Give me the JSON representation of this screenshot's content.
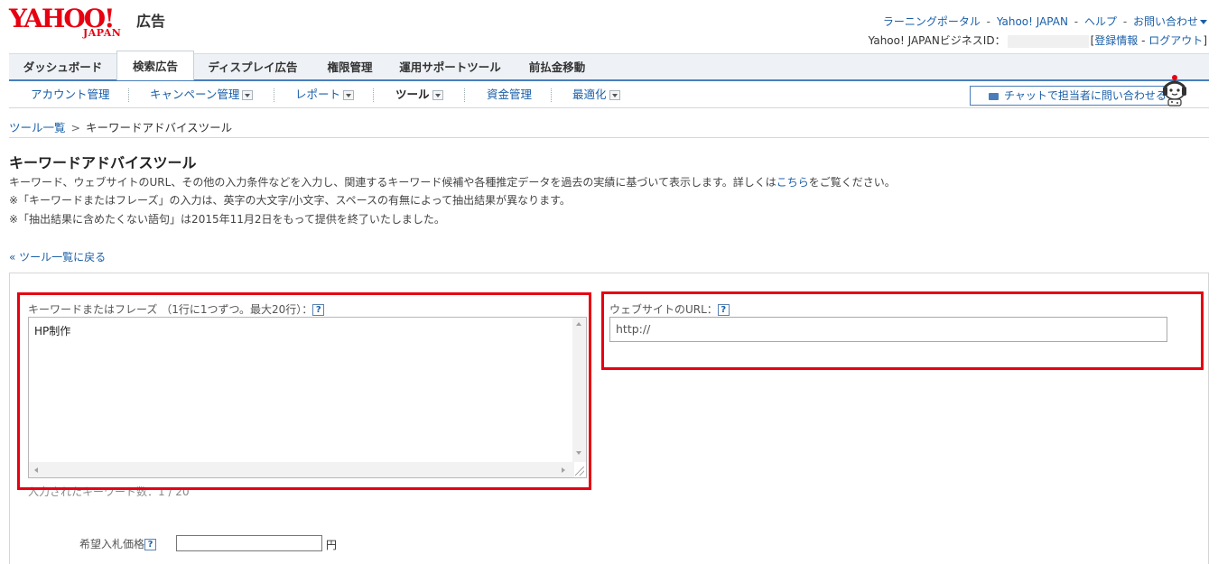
{
  "brand": {
    "logo_main": "YAHOO!",
    "logo_sub": "JAPAN",
    "logo_product": "広告"
  },
  "top_links": {
    "items": [
      "ラーニングポータル",
      "Yahoo! JAPAN",
      "ヘルプ",
      "お問い合わせ"
    ],
    "separator": "-"
  },
  "account": {
    "bizid_label": "Yahoo! JAPANビジネスID：",
    "bracket_open": "[",
    "registration": "登録情報",
    "separator": "-",
    "logout": "ログアウト",
    "bracket_close": "]"
  },
  "main_tabs": [
    {
      "label": "ダッシュボード",
      "active": false
    },
    {
      "label": "検索広告",
      "active": true
    },
    {
      "label": "ディスプレイ広告",
      "active": false
    },
    {
      "label": "権限管理",
      "active": false
    },
    {
      "label": "運用サポートツール",
      "active": false
    },
    {
      "label": "前払金移動",
      "active": false
    }
  ],
  "sub_nav": [
    {
      "label": "アカウント管理",
      "dropdown": false,
      "current": false
    },
    {
      "label": "キャンペーン管理",
      "dropdown": true,
      "current": false
    },
    {
      "label": "レポート",
      "dropdown": true,
      "current": false
    },
    {
      "label": "ツール",
      "dropdown": true,
      "current": true
    },
    {
      "label": "資金管理",
      "dropdown": false,
      "current": false
    },
    {
      "label": "最適化",
      "dropdown": true,
      "current": false
    }
  ],
  "chat_button": {
    "label": "チャットで担当者に問い合わせる"
  },
  "breadcrumb": {
    "parent": "ツール一覧",
    "arrow": ">",
    "current": "キーワードアドバイスツール"
  },
  "page": {
    "title": "キーワードアドバイスツール",
    "desc_line1_prefix": "キーワード、ウェブサイトのURL、その他の入力条件などを入力し、関連するキーワード候補や各種推定データを過去の実績に基づいて表示します。詳しくは",
    "desc_line1_link": "こちら",
    "desc_line1_suffix": "をご覧ください。",
    "note1": "※「キーワードまたはフレーズ」の入力は、英字の大文字/小文字、スペースの有無によって抽出結果が異なります。",
    "note2": "※「抽出結果に含めたくない語句」は2015年11月2日をもって提供を終了いたしました。",
    "back_link": "« ツール一覧に戻る"
  },
  "form": {
    "keyword_label": "キーワードまたはフレーズ （1行に1つずつ。最大20行）：",
    "keyword_value": "HP制作",
    "keyword_count": "入力されたキーワード数：1 / 20",
    "url_label": "ウェブサイトのURL：",
    "url_value": "http://",
    "bid_label": "希望入札価格",
    "bid_value": "",
    "bid_unit": "円",
    "help_glyph": "?"
  },
  "colors": {
    "brand_red": "#e60012",
    "link_blue": "#1a5fa8",
    "highlight_red": "#e60012"
  }
}
